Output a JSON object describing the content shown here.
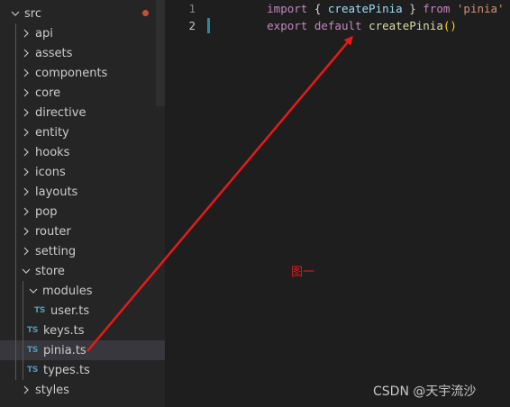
{
  "explorer": {
    "root": {
      "label": "src",
      "modified": true
    },
    "folders_top": [
      "api",
      "assets",
      "components",
      "core",
      "directive",
      "entity",
      "hooks",
      "icons",
      "layouts",
      "pop",
      "router",
      "setting"
    ],
    "store": {
      "label": "store",
      "modules": {
        "label": "modules",
        "files": [
          {
            "badge": "TS",
            "label": "user.ts"
          }
        ]
      },
      "files": [
        {
          "badge": "TS",
          "label": "keys.ts"
        },
        {
          "badge": "TS",
          "label": "pinia.ts"
        },
        {
          "badge": "TS",
          "label": "types.ts"
        }
      ]
    },
    "folders_bottom": [
      "styles"
    ]
  },
  "editor": {
    "lines": [
      {
        "number": "1",
        "tokens": [
          "import",
          " { ",
          "createPinia",
          " } ",
          "from",
          " ",
          "'pinia'"
        ]
      },
      {
        "number": "2",
        "tokens": [
          "export",
          " ",
          "default",
          " ",
          "createPinia",
          "()"
        ]
      }
    ]
  },
  "annotation": {
    "label": "图一",
    "color": "#e51b1b"
  },
  "watermark": "CSDN @天宇流沙",
  "colors": {
    "sidebar_bg": "#252526",
    "editor_bg": "#1e1e1e",
    "ts_badge": "#519aba",
    "selection": "#37373d"
  }
}
